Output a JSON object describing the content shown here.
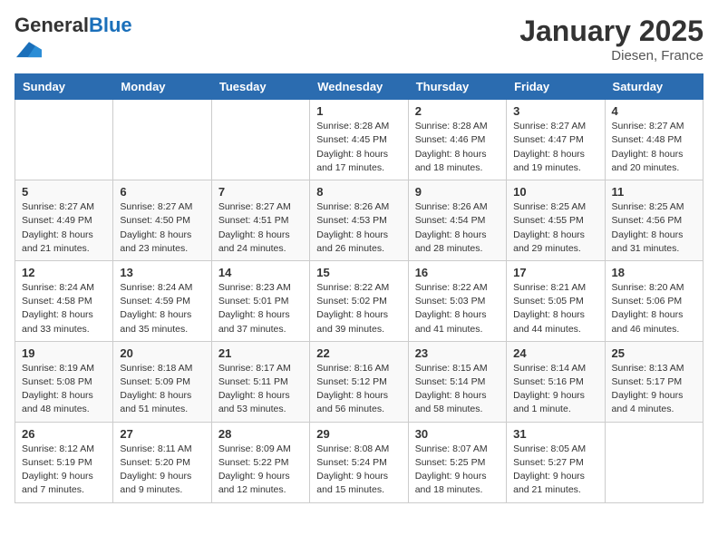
{
  "logo": {
    "general": "General",
    "blue": "Blue"
  },
  "header": {
    "month_year": "January 2025",
    "location": "Diesen, France"
  },
  "weekdays": [
    "Sunday",
    "Monday",
    "Tuesday",
    "Wednesday",
    "Thursday",
    "Friday",
    "Saturday"
  ],
  "weeks": [
    [
      {
        "day": "",
        "text": ""
      },
      {
        "day": "",
        "text": ""
      },
      {
        "day": "",
        "text": ""
      },
      {
        "day": "1",
        "text": "Sunrise: 8:28 AM\nSunset: 4:45 PM\nDaylight: 8 hours\nand 17 minutes."
      },
      {
        "day": "2",
        "text": "Sunrise: 8:28 AM\nSunset: 4:46 PM\nDaylight: 8 hours\nand 18 minutes."
      },
      {
        "day": "3",
        "text": "Sunrise: 8:27 AM\nSunset: 4:47 PM\nDaylight: 8 hours\nand 19 minutes."
      },
      {
        "day": "4",
        "text": "Sunrise: 8:27 AM\nSunset: 4:48 PM\nDaylight: 8 hours\nand 20 minutes."
      }
    ],
    [
      {
        "day": "5",
        "text": "Sunrise: 8:27 AM\nSunset: 4:49 PM\nDaylight: 8 hours\nand 21 minutes."
      },
      {
        "day": "6",
        "text": "Sunrise: 8:27 AM\nSunset: 4:50 PM\nDaylight: 8 hours\nand 23 minutes."
      },
      {
        "day": "7",
        "text": "Sunrise: 8:27 AM\nSunset: 4:51 PM\nDaylight: 8 hours\nand 24 minutes."
      },
      {
        "day": "8",
        "text": "Sunrise: 8:26 AM\nSunset: 4:53 PM\nDaylight: 8 hours\nand 26 minutes."
      },
      {
        "day": "9",
        "text": "Sunrise: 8:26 AM\nSunset: 4:54 PM\nDaylight: 8 hours\nand 28 minutes."
      },
      {
        "day": "10",
        "text": "Sunrise: 8:25 AM\nSunset: 4:55 PM\nDaylight: 8 hours\nand 29 minutes."
      },
      {
        "day": "11",
        "text": "Sunrise: 8:25 AM\nSunset: 4:56 PM\nDaylight: 8 hours\nand 31 minutes."
      }
    ],
    [
      {
        "day": "12",
        "text": "Sunrise: 8:24 AM\nSunset: 4:58 PM\nDaylight: 8 hours\nand 33 minutes."
      },
      {
        "day": "13",
        "text": "Sunrise: 8:24 AM\nSunset: 4:59 PM\nDaylight: 8 hours\nand 35 minutes."
      },
      {
        "day": "14",
        "text": "Sunrise: 8:23 AM\nSunset: 5:01 PM\nDaylight: 8 hours\nand 37 minutes."
      },
      {
        "day": "15",
        "text": "Sunrise: 8:22 AM\nSunset: 5:02 PM\nDaylight: 8 hours\nand 39 minutes."
      },
      {
        "day": "16",
        "text": "Sunrise: 8:22 AM\nSunset: 5:03 PM\nDaylight: 8 hours\nand 41 minutes."
      },
      {
        "day": "17",
        "text": "Sunrise: 8:21 AM\nSunset: 5:05 PM\nDaylight: 8 hours\nand 44 minutes."
      },
      {
        "day": "18",
        "text": "Sunrise: 8:20 AM\nSunset: 5:06 PM\nDaylight: 8 hours\nand 46 minutes."
      }
    ],
    [
      {
        "day": "19",
        "text": "Sunrise: 8:19 AM\nSunset: 5:08 PM\nDaylight: 8 hours\nand 48 minutes."
      },
      {
        "day": "20",
        "text": "Sunrise: 8:18 AM\nSunset: 5:09 PM\nDaylight: 8 hours\nand 51 minutes."
      },
      {
        "day": "21",
        "text": "Sunrise: 8:17 AM\nSunset: 5:11 PM\nDaylight: 8 hours\nand 53 minutes."
      },
      {
        "day": "22",
        "text": "Sunrise: 8:16 AM\nSunset: 5:12 PM\nDaylight: 8 hours\nand 56 minutes."
      },
      {
        "day": "23",
        "text": "Sunrise: 8:15 AM\nSunset: 5:14 PM\nDaylight: 8 hours\nand 58 minutes."
      },
      {
        "day": "24",
        "text": "Sunrise: 8:14 AM\nSunset: 5:16 PM\nDaylight: 9 hours\nand 1 minute."
      },
      {
        "day": "25",
        "text": "Sunrise: 8:13 AM\nSunset: 5:17 PM\nDaylight: 9 hours\nand 4 minutes."
      }
    ],
    [
      {
        "day": "26",
        "text": "Sunrise: 8:12 AM\nSunset: 5:19 PM\nDaylight: 9 hours\nand 7 minutes."
      },
      {
        "day": "27",
        "text": "Sunrise: 8:11 AM\nSunset: 5:20 PM\nDaylight: 9 hours\nand 9 minutes."
      },
      {
        "day": "28",
        "text": "Sunrise: 8:09 AM\nSunset: 5:22 PM\nDaylight: 9 hours\nand 12 minutes."
      },
      {
        "day": "29",
        "text": "Sunrise: 8:08 AM\nSunset: 5:24 PM\nDaylight: 9 hours\nand 15 minutes."
      },
      {
        "day": "30",
        "text": "Sunrise: 8:07 AM\nSunset: 5:25 PM\nDaylight: 9 hours\nand 18 minutes."
      },
      {
        "day": "31",
        "text": "Sunrise: 8:05 AM\nSunset: 5:27 PM\nDaylight: 9 hours\nand 21 minutes."
      },
      {
        "day": "",
        "text": ""
      }
    ]
  ]
}
